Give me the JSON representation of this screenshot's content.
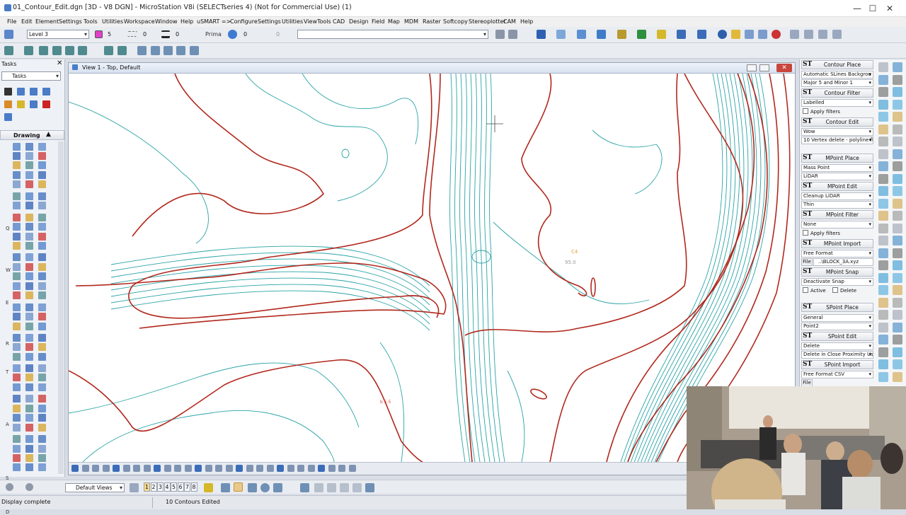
{
  "window": {
    "title": "01_Contour_Edit.dgn [3D - V8 DGN] - MicroStation V8i (SELECTseries 4) (Not for Commercial Use) (1)"
  },
  "menu": [
    "File",
    "Edit",
    "Element",
    "Settings",
    "Tools",
    "Utilities",
    "Workspace",
    "Window",
    "Help",
    "uSMART =>",
    "Configure",
    "Settings",
    "Utilities",
    "ViewTools",
    "CAD",
    "Design",
    "Field",
    "Map",
    "MDM",
    "Raster",
    "Softcopy",
    "Stereoplotter",
    "CAM",
    "Help"
  ],
  "attributes": {
    "level": "Level 3",
    "color_index": "5",
    "weight": "0",
    "style": "0",
    "prima": "Prima",
    "transparency": "0",
    "priority": "0"
  },
  "tasks": {
    "title": "Tasks",
    "dropdown": "Tasks",
    "drawing": "Drawing",
    "side_letters": [
      "Q",
      "W",
      "E",
      "R",
      "T",
      "A",
      "S",
      "D"
    ]
  },
  "view": {
    "title": "View 1 - Top, Default",
    "label_c4": "C4",
    "label_value": "95.0",
    "label_footer": "b 5.5"
  },
  "contour_place": {
    "header": "Contour Place",
    "mode": "Automatic SLines Backgrou",
    "interval": "Major 5 and Minor 1"
  },
  "contour_filter": {
    "header": "Contour Filter",
    "filter": "Labelled",
    "apply": "Apply filters"
  },
  "contour_edit": {
    "header": "Contour Edit",
    "mode": "Wow",
    "vertex": "10 Vertex delete - polyline fit"
  },
  "mpoint_place": {
    "header": "MPoint Place",
    "type": "Mass Point",
    "source": "LiDAR"
  },
  "mpoint_edit": {
    "header": "MPoint Edit",
    "mode": "Cleanup LiDAR",
    "thin": "Thin"
  },
  "mpoint_filter": {
    "header": "MPoint Filter",
    "filter": "None",
    "apply": "Apply filters"
  },
  "mpoint_import": {
    "header": "MPoint Import",
    "format": "Free Format",
    "file_btn": "File",
    "file": "..\\BLOCK_3A.xyz"
  },
  "mpoint_snap": {
    "header": "MPoint Snap",
    "mode": "Deactivate Snap",
    "active": "Active",
    "delete": "Delete"
  },
  "spoint_place": {
    "header": "SPoint Place",
    "type": "General",
    "point": "Point2"
  },
  "spoint_edit": {
    "header": "SPoint Edit",
    "mode": "Delete",
    "proximity": "Delete in Close Proximity Us"
  },
  "spoint_import": {
    "header": "SPoint Import",
    "format": "Free Format CSV",
    "file_btn": "File"
  },
  "bottom": {
    "views": "Default Views",
    "view_numbers": [
      "1",
      "2",
      "3",
      "4",
      "5",
      "6",
      "7",
      "8"
    ]
  },
  "status": {
    "left": "Display complete",
    "message": "10 Contours Edited"
  },
  "colors": {
    "index_contour": "#b2281d",
    "minor_contour": "#2aa3a6",
    "active_color": "#e040c8"
  }
}
